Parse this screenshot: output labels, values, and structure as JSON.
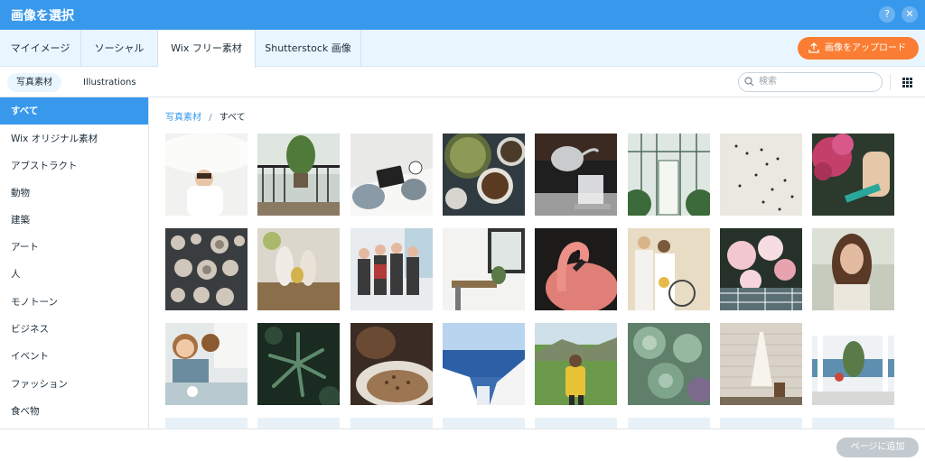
{
  "window": {
    "title": "画像を選択",
    "help_icon": "?",
    "close_icon": "✕"
  },
  "tabs": [
    {
      "label": "マイイメージ",
      "active": false
    },
    {
      "label": "ソーシャル",
      "active": false
    },
    {
      "label": "Wix フリー素材",
      "active": true
    },
    {
      "label": "Shutterstock 画像",
      "active": false
    }
  ],
  "upload_button": {
    "label": "画像をアップロード",
    "icon": "upload-icon",
    "color": "#fb7d33"
  },
  "subtabs": [
    {
      "label": "写真素材",
      "active": true
    },
    {
      "label": "Illustrations",
      "active": false
    }
  ],
  "search": {
    "placeholder": "検索",
    "icon": "search-icon"
  },
  "view_toggle": {
    "icon": "grid-view-icon"
  },
  "sidebar": {
    "items": [
      {
        "label": "すべて",
        "active": true
      },
      {
        "label": "Wix オリジナル素材",
        "active": false
      },
      {
        "label": "アブストラクト",
        "active": false
      },
      {
        "label": "動物",
        "active": false
      },
      {
        "label": "建築",
        "active": false
      },
      {
        "label": "アート",
        "active": false
      },
      {
        "label": "人",
        "active": false
      },
      {
        "label": "モノトーン",
        "active": false
      },
      {
        "label": "ビジネス",
        "active": false
      },
      {
        "label": "イベント",
        "active": false
      },
      {
        "label": "ファッション",
        "active": false
      },
      {
        "label": "食べ物",
        "active": false
      }
    ]
  },
  "breadcrumb": {
    "parent": "写真素材",
    "separator": "/",
    "current": "すべて"
  },
  "images": [
    {
      "subject": "woman with white umbrella"
    },
    {
      "subject": "plant on balcony railing"
    },
    {
      "subject": "hands with tablet and coffee"
    },
    {
      "subject": "bowls of spices and herbs"
    },
    {
      "subject": "pour-over coffee kettle"
    },
    {
      "subject": "greenhouse interior"
    },
    {
      "subject": "aerial view of people on white ground"
    },
    {
      "subject": "pink hydrangea flowers"
    },
    {
      "subject": "ceramic plates on dark table"
    },
    {
      "subject": "easter bunny decorations"
    },
    {
      "subject": "team meeting in office"
    },
    {
      "subject": "bright bathroom with window"
    },
    {
      "subject": "flamingo close-up"
    },
    {
      "subject": "bride with bicycle"
    },
    {
      "subject": "peonies on checkered cloth"
    },
    {
      "subject": "woman with long hair"
    },
    {
      "subject": "children painting at table"
    },
    {
      "subject": "dark green leaves"
    },
    {
      "subject": "roasted coffee beans"
    },
    {
      "subject": "santorini sea view"
    },
    {
      "subject": "hiker in green valley"
    },
    {
      "subject": "succulent plants"
    },
    {
      "subject": "wedding dress on brick wall"
    },
    {
      "subject": "white terrace by the sea"
    }
  ],
  "footer": {
    "add_button_label": "ページに追加"
  },
  "colors": {
    "accent": "#3899ec",
    "tab_bg": "#eaf6ff",
    "disabled": "#c2c9cf"
  }
}
